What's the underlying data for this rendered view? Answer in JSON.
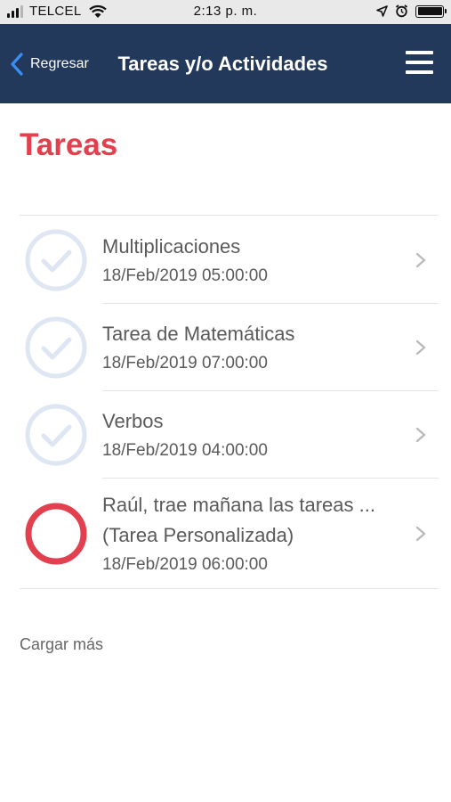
{
  "status_bar": {
    "carrier": "TELCEL",
    "time": "2:13 p. m."
  },
  "nav": {
    "back_label": "Regresar",
    "title": "Tareas y/o Actividades"
  },
  "section_title": "Tareas",
  "colors": {
    "nav_background": "#23395b",
    "accent_red": "#e3404f",
    "completed_icon": "#dde6f2",
    "text_gray": "#5a5a5a"
  },
  "tasks": [
    {
      "title": "Multiplicaciones",
      "date": "18/Feb/2019 05:00:00",
      "status": "completed",
      "icon": "check-circle-icon"
    },
    {
      "title": "Tarea de Matemáticas",
      "date": "18/Feb/2019 07:00:00",
      "status": "completed",
      "icon": "check-circle-icon"
    },
    {
      "title": "Verbos",
      "date": "18/Feb/2019 04:00:00",
      "status": "completed",
      "icon": "check-circle-icon"
    },
    {
      "title": "Raúl, trae mañana las tareas ...",
      "subtitle": "(Tarea Personalizada)",
      "date": "18/Feb/2019 06:00:00",
      "status": "pending",
      "icon": "pending-circle-icon"
    }
  ],
  "load_more": "Cargar más"
}
